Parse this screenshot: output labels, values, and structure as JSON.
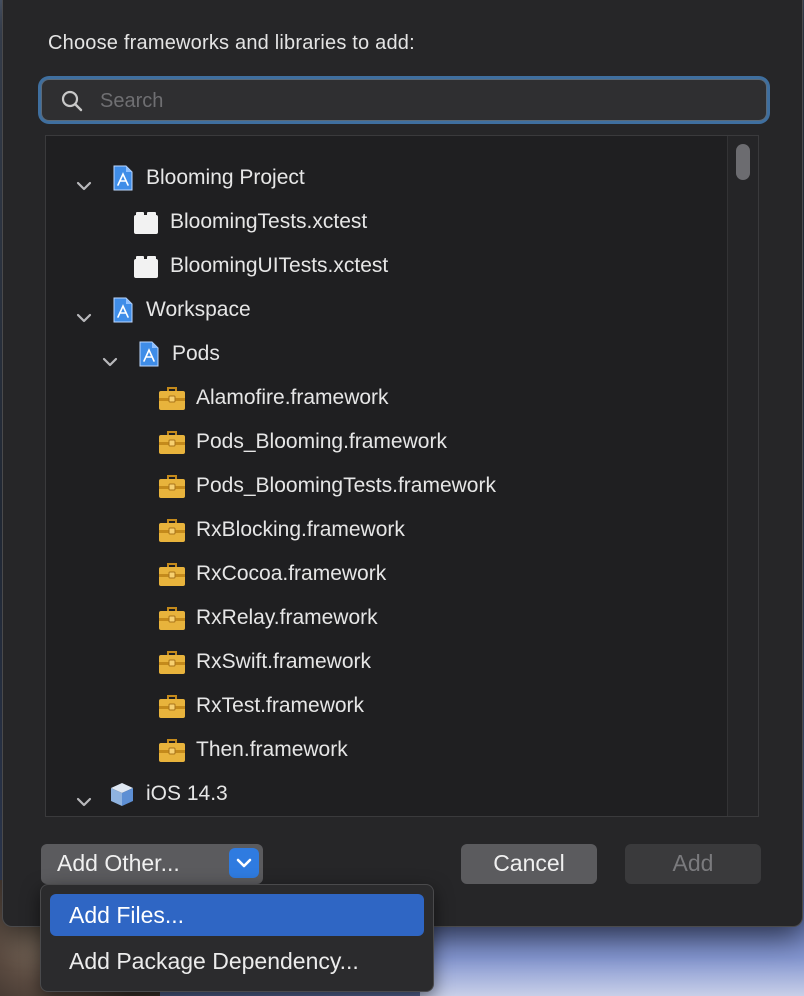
{
  "dialog": {
    "heading": "Choose frameworks and libraries to add:",
    "search": {
      "placeholder": "Search",
      "value": ""
    }
  },
  "tree": {
    "rows": [
      {
        "label": "Blooming Project",
        "level": 0,
        "icon": "xcode-project-icon",
        "expanded": true
      },
      {
        "label": "BloomingTests.xctest",
        "level": 1,
        "icon": "bundle-icon"
      },
      {
        "label": "BloomingUITests.xctest",
        "level": 1,
        "icon": "bundle-icon"
      },
      {
        "label": "Workspace",
        "level": 0,
        "icon": "xcode-project-icon",
        "expanded": true
      },
      {
        "label": "Pods",
        "level": 1,
        "icon": "xcode-project-icon",
        "expanded": true
      },
      {
        "label": "Alamofire.framework",
        "level": 2,
        "icon": "framework-toolbox-icon"
      },
      {
        "label": "Pods_Blooming.framework",
        "level": 2,
        "icon": "framework-toolbox-icon"
      },
      {
        "label": "Pods_BloomingTests.framework",
        "level": 2,
        "icon": "framework-toolbox-icon"
      },
      {
        "label": "RxBlocking.framework",
        "level": 2,
        "icon": "framework-toolbox-icon"
      },
      {
        "label": "RxCocoa.framework",
        "level": 2,
        "icon": "framework-toolbox-icon"
      },
      {
        "label": "RxRelay.framework",
        "level": 2,
        "icon": "framework-toolbox-icon"
      },
      {
        "label": "RxSwift.framework",
        "level": 2,
        "icon": "framework-toolbox-icon"
      },
      {
        "label": "RxTest.framework",
        "level": 2,
        "icon": "framework-toolbox-icon"
      },
      {
        "label": "Then.framework",
        "level": 2,
        "icon": "framework-toolbox-icon"
      },
      {
        "label": "iOS 14.3",
        "level": 0,
        "icon": "sdk-box-icon",
        "expanded": true
      }
    ]
  },
  "footer": {
    "add_other_label": "Add Other...",
    "cancel_label": "Cancel",
    "add_label": "Add"
  },
  "menu": {
    "items": [
      {
        "label": "Add Files...",
        "selected": true
      },
      {
        "label": "Add Package Dependency..."
      }
    ]
  },
  "colors": {
    "accent": "#2f7be0",
    "selection": "#2f66c4",
    "background": "#262628",
    "framework_icon": "#e8b33c"
  }
}
